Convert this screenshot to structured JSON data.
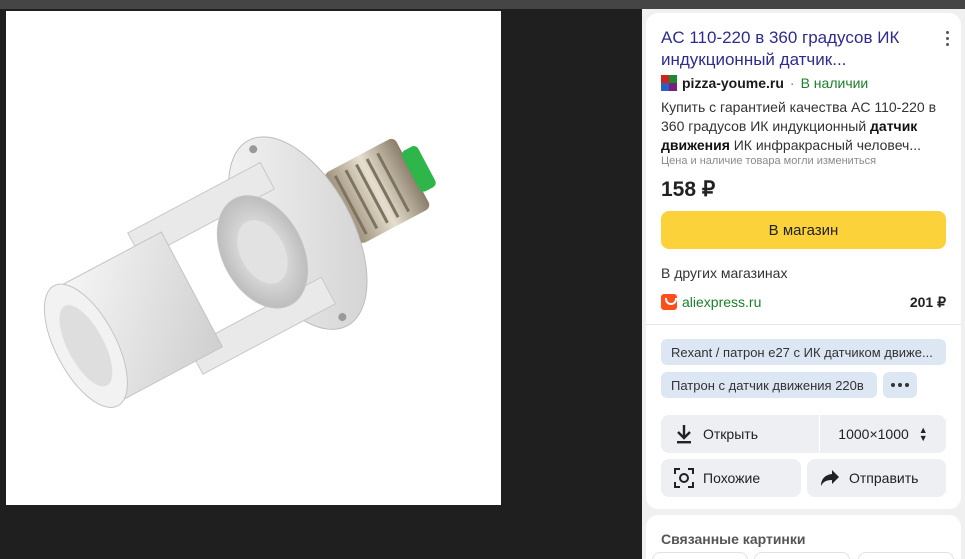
{
  "product": {
    "title": "AC 110-220 в 360 градусов ИК индукционный датчик...",
    "source_domain": "pizza-youme.ru",
    "source_separator": "·",
    "availability": "В наличии",
    "desc_start": "Купить с гарантией качества AC 110-220 в 360 градусов ИК индукционный ",
    "desc_bold": "датчик движения",
    "desc_end": " ИК инфракрасный человеч...",
    "price_note": "Цена и наличие товара могли измениться",
    "price": "158 ₽",
    "shop_button": "В магазин"
  },
  "other_shops": {
    "heading": "В других магазинах",
    "items": [
      {
        "name": "aliexpress.ru",
        "price": "201 ₽"
      }
    ]
  },
  "tags": [
    "Rexant / патрон е27 с ИК датчиком движе...",
    "Патрон с датчик движения 220в"
  ],
  "actions": {
    "open_label": "Открыть",
    "size_label": "1000×1000",
    "similar_label": "Похожие",
    "share_label": "Отправить"
  },
  "related": {
    "heading": "Связанные картинки"
  },
  "colors": {
    "title": "#2e2c8f",
    "shop_button": "#fcd23a",
    "availability": "#1b7f2a",
    "tag_bg": "#dde6f3"
  },
  "icons": {
    "more": "more-vertical-icon",
    "download": "download-icon",
    "similar": "lens-icon",
    "share": "share-arrow-icon",
    "sort": "sort-arrows-icon"
  }
}
